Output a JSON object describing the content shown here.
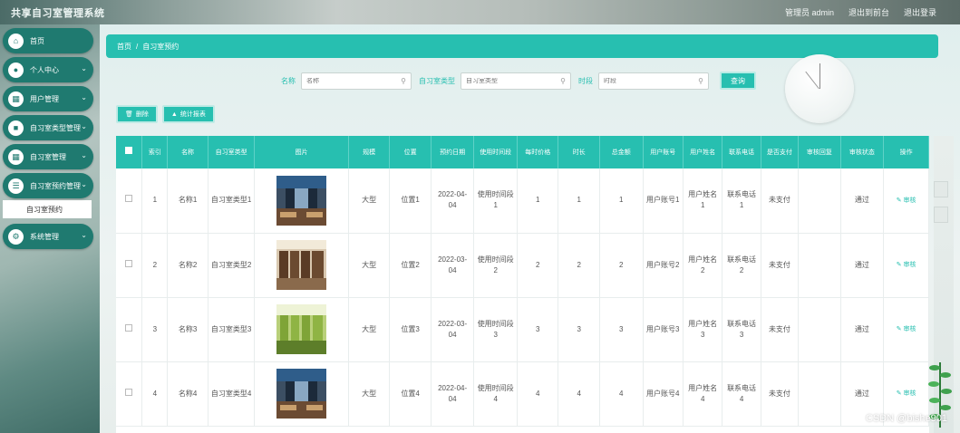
{
  "app": {
    "title": "共享自习室管理系统",
    "user_info": "管理员 admin",
    "links": [
      "退出到前台",
      "退出登录"
    ]
  },
  "sidebar": {
    "items": [
      {
        "label": "首页",
        "icon": "home-icon",
        "has_children": false
      },
      {
        "label": "个人中心",
        "icon": "user-icon",
        "has_children": true
      },
      {
        "label": "用户管理",
        "icon": "grid-icon",
        "has_children": true
      },
      {
        "label": "自习室类型管理",
        "icon": "folder-icon",
        "has_children": true
      },
      {
        "label": "自习室管理",
        "icon": "grid-icon",
        "has_children": true
      },
      {
        "label": "自习室预约管理",
        "icon": "list-icon",
        "has_children": true,
        "expanded": true
      },
      {
        "label": "系统管理",
        "icon": "gear-icon",
        "has_children": true
      }
    ],
    "subitem": "自习室预约"
  },
  "breadcrumb": {
    "home": "首页",
    "separator": "/",
    "current": "自习室预约"
  },
  "search": {
    "fields": [
      {
        "label": "名称",
        "placeholder": "名称"
      },
      {
        "label": "自习室类型",
        "placeholder": "自习室类型"
      },
      {
        "label": "时段",
        "placeholder": "时段"
      }
    ],
    "query_label": "查询"
  },
  "actions": {
    "delete_label": "删除",
    "stats_label": "统计报表"
  },
  "table": {
    "headers": [
      "",
      "索引",
      "名称",
      "自习室类型",
      "图片",
      "规模",
      "位置",
      "预约日期",
      "使用时间段",
      "每时价格",
      "时长",
      "总金额",
      "用户账号",
      "用户姓名",
      "联系电话",
      "是否支付",
      "审核回复",
      "审核状态",
      "操作"
    ],
    "rows": [
      {
        "index": "1",
        "name": "名称1",
        "type": "自习室类型1",
        "scale": "大型",
        "location": "位置1",
        "date": "2022-04-04",
        "period": "使用时间段1",
        "price": "1",
        "duration": "1",
        "total": "1",
        "account": "用户账号1",
        "username": "用户姓名1",
        "phone": "联系电话1",
        "paid": "未支付",
        "reply": "",
        "status": "通过",
        "op": "审核",
        "img": "study-room-1"
      },
      {
        "index": "2",
        "name": "名称2",
        "type": "自习室类型2",
        "scale": "大型",
        "location": "位置2",
        "date": "2022-03-04",
        "period": "使用时间段2",
        "price": "2",
        "duration": "2",
        "total": "2",
        "account": "用户账号2",
        "username": "用户姓名2",
        "phone": "联系电话2",
        "paid": "未支付",
        "reply": "",
        "status": "通过",
        "op": "审核",
        "img": "study-room-2"
      },
      {
        "index": "3",
        "name": "名称3",
        "type": "自习室类型3",
        "scale": "大型",
        "location": "位置3",
        "date": "2022-03-04",
        "period": "使用时间段3",
        "price": "3",
        "duration": "3",
        "total": "3",
        "account": "用户账号3",
        "username": "用户姓名3",
        "phone": "联系电话3",
        "paid": "未支付",
        "reply": "",
        "status": "通过",
        "op": "审核",
        "img": "study-room-3"
      },
      {
        "index": "4",
        "name": "名称4",
        "type": "自习室类型4",
        "scale": "大型",
        "location": "位置4",
        "date": "2022-04-04",
        "period": "使用时间段4",
        "price": "4",
        "duration": "4",
        "total": "4",
        "account": "用户账号4",
        "username": "用户姓名4",
        "phone": "联系电话4",
        "paid": "未支付",
        "reply": "",
        "status": "通过",
        "op": "审核",
        "img": "study-room-4"
      }
    ]
  },
  "watermark": "CSDN @bishe901",
  "colors": {
    "accent": "#27bfb0",
    "sidebar": "#1f7a70"
  }
}
